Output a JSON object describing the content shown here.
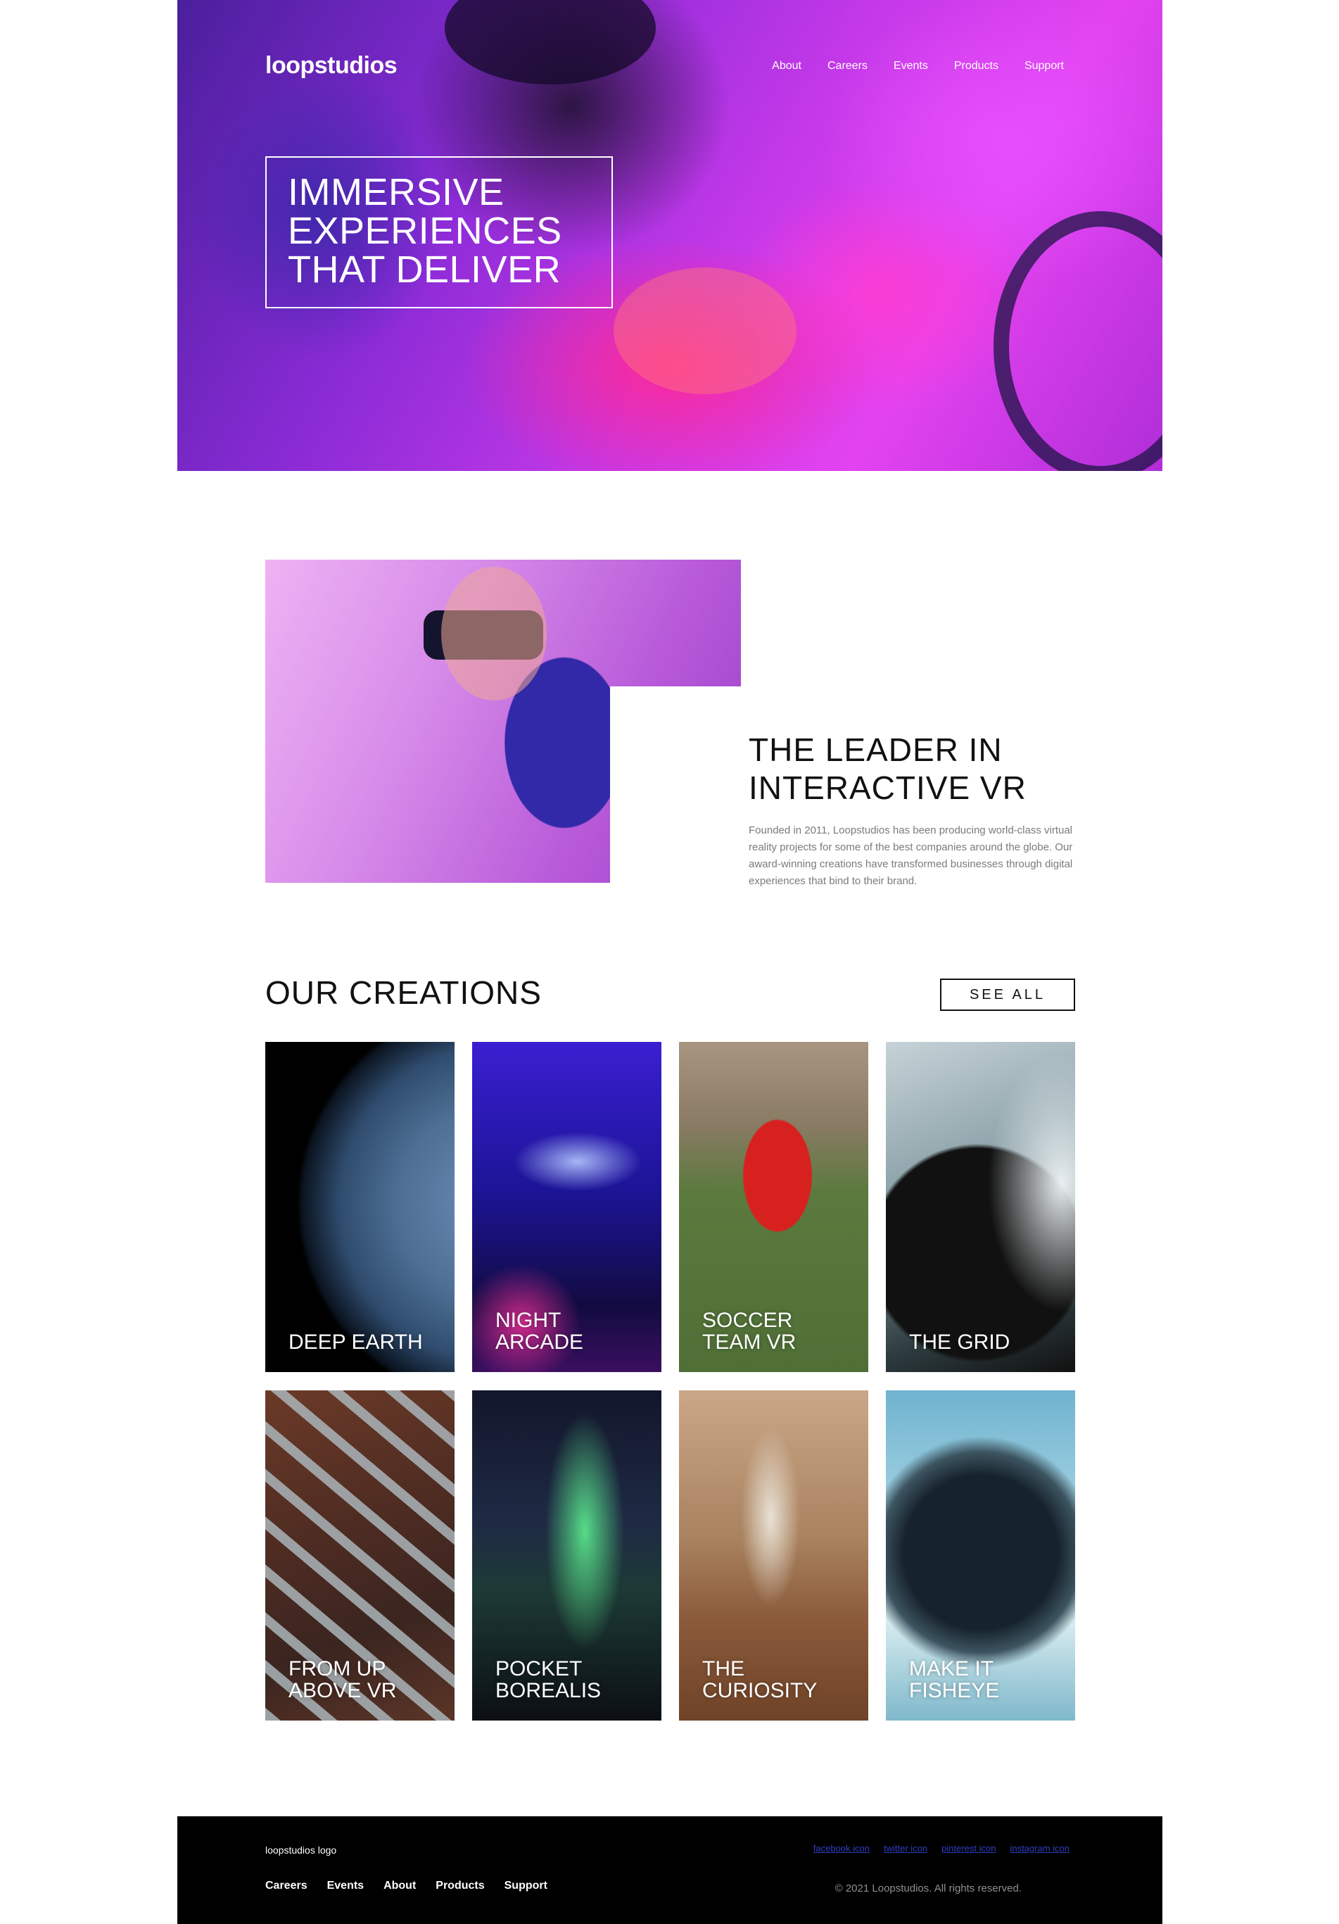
{
  "header": {
    "logo": "loopstudios",
    "nav": [
      "About",
      "Careers",
      "Events",
      "Products",
      "Support"
    ]
  },
  "hero": {
    "title": "IMMERSIVE EXPERIENCES THAT DELIVER"
  },
  "leader": {
    "title": "THE LEADER IN INTERACTIVE VR",
    "body": "Founded in 2011, Loopstudios has been producing world-class virtual reality projects for some of the best companies around the globe. Our award-winning creations have transformed businesses through digital experiences that bind to their brand."
  },
  "creations": {
    "title": "OUR CREATIONS",
    "see_all": "SEE ALL",
    "items": [
      {
        "label": "DEEP EARTH"
      },
      {
        "label": "NIGHT ARCADE"
      },
      {
        "label": "SOCCER TEAM VR"
      },
      {
        "label": "THE GRID"
      },
      {
        "label": "FROM UP ABOVE VR"
      },
      {
        "label": "POCKET BOREALIS"
      },
      {
        "label": "THE CURIOSITY"
      },
      {
        "label": "MAKE IT FISHEYE"
      }
    ]
  },
  "footer": {
    "logo_alt": "loopstudios logo",
    "nav": [
      "Careers",
      "Events",
      "About",
      "Products",
      "Support"
    ],
    "social": [
      "facebook icon",
      "twitter icon",
      "pinterest icon",
      "instagram icon"
    ],
    "copyright": "© 2021 Loopstudios. All rights reserved."
  }
}
